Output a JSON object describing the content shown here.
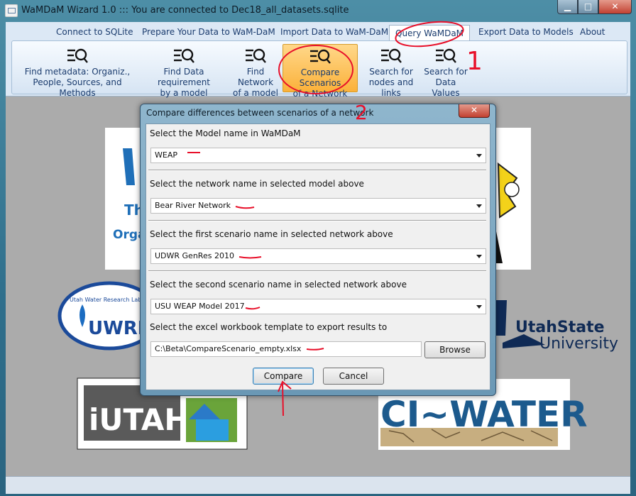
{
  "window": {
    "title": "WaMDaM Wizard 1.0 ::: You are connected to Dec18_all_datasets.sqlite",
    "minimize": "▁",
    "maximize": "□",
    "close": "✕"
  },
  "tabs": [
    {
      "label": "Connect to SQLite"
    },
    {
      "label": "Prepare Your Data to WaM-DaM"
    },
    {
      "label": "Import Data to WaM-DaM"
    },
    {
      "label": "Query WaMDaM"
    },
    {
      "label": "Export Data to Models"
    },
    {
      "label": "About"
    }
  ],
  "ribbon": [
    {
      "label1": "Find metadata: Organiz.,",
      "label2": "People, Sources, and Methods"
    },
    {
      "label1": "Find Data requirement",
      "label2": "by a model"
    },
    {
      "label1": "Find Network",
      "label2": "of a model"
    },
    {
      "label1": "Compare Scenarios",
      "label2": "of a Network"
    },
    {
      "label1": "Search for",
      "label2": "nodes and links"
    },
    {
      "label1": "Search for",
      "label2": "Data Values"
    }
  ],
  "dialog": {
    "title": "Compare differences between scenarios of a network",
    "close": "✕",
    "model_label": "Select the Model name in WaMDaM",
    "model_value": "WEAP",
    "network_label": "Select the network name in selected model above",
    "network_value": "Bear River Network",
    "scenario1_label": "Select the first scenario name in selected network above",
    "scenario1_value": "UDWR GenRes 2010",
    "scenario2_label": "Select the second scenario name in selected network above",
    "scenario2_value": "USU WEAP Model 2017",
    "template_label": "Select the excel workbook template to export results to",
    "template_value": "C:\\Beta\\CompareScenario_empty.xlsx",
    "browse": "Browse",
    "compare": "Compare",
    "cancel": "Cancel"
  },
  "annotations": {
    "one": "1",
    "two": "2",
    "arrow_one": "1"
  },
  "logos": {
    "uwrl": "UWRL",
    "uwrl_ring": "Utah Water Research Labora",
    "usu_line1": "UtahState",
    "usu_line2": "University",
    "iutah": "iUTAH",
    "ciwater": "CI~WATER",
    "wamdam_the": "The",
    "wamdam_orga": "Orga"
  },
  "colors": {
    "accent_red": "#e8102a",
    "selected_tab": "#fbb13a",
    "ribbon_text": "#1b3c6e"
  }
}
